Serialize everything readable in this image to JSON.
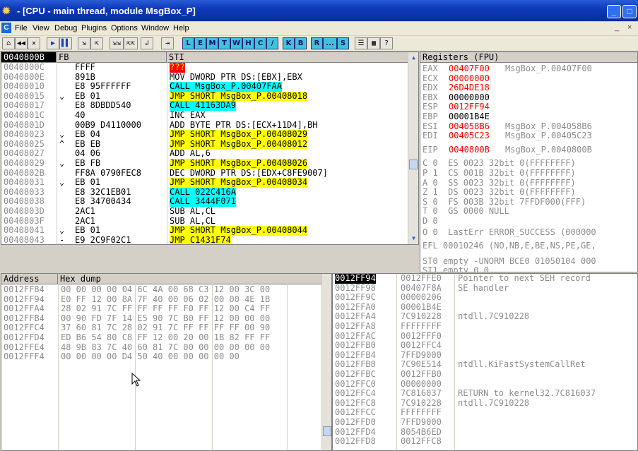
{
  "window": {
    "title": "- [CPU - main thread, module MsgBox_P]",
    "min": "_",
    "max": "□",
    "close": "✕"
  },
  "menu": [
    "File",
    "View",
    "Debug",
    "Plugins",
    "Options",
    "Window",
    "Help"
  ],
  "menu_c": "C",
  "menu_right_min": "_",
  "menu_right_close": "×",
  "toolbar": {
    "std": [
      "⌂",
      "◀◀",
      "✕",
      "▶",
      "▌▌",
      "⇲",
      "⇱",
      "⇲⇲",
      "⇱⇱",
      "↲",
      "⇥"
    ],
    "letters": [
      "L",
      "E",
      "M",
      "T",
      "W",
      "H",
      "C",
      "/",
      "K",
      "B",
      "R",
      "...",
      "S"
    ],
    "extra": [
      "☰",
      "▦",
      "?"
    ]
  },
  "disasm": {
    "headers": [
      "0040800B",
      "FB",
      "STI"
    ],
    "rows": [
      {
        "addr": "0040800C",
        "jmp": " ",
        "hex": "FFFF",
        "ins": "???",
        "cls": "redbg"
      },
      {
        "addr": "0040800E",
        "jmp": " ",
        "hex": "891B",
        "ins": "MOV DWORD PTR DS:[EBX],EBX",
        "cls": ""
      },
      {
        "addr": "00408010",
        "jmp": " ",
        "hex": "E8 95FFFFFF",
        "ins": "CALL MsgBox_P.00407FAA",
        "cls": "cy"
      },
      {
        "addr": "00408015",
        "jmp": "⌄",
        "hex": "EB 01",
        "ins": "JMP SHORT MsgBox_P.00408018",
        "cls": "hl"
      },
      {
        "addr": "00408017",
        "jmp": " ",
        "hex": "E8 8DBDD540",
        "ins": "CALL 41163DA9",
        "cls": "cy"
      },
      {
        "addr": "0040801C",
        "jmp": " ",
        "hex": "40",
        "ins": "INC EAX",
        "cls": ""
      },
      {
        "addr": "0040801D",
        "jmp": " ",
        "hex": "00B9 D4110000",
        "ins": "ADD BYTE PTR DS:[ECX+11D4],BH",
        "cls": ""
      },
      {
        "addr": "00408023",
        "jmp": "⌄",
        "hex": "EB 04",
        "ins": "JMP SHORT MsgBox_P.00408029",
        "cls": "hl"
      },
      {
        "addr": "00408025",
        "jmp": "^",
        "hex": "EB EB",
        "ins": "JMP SHORT MsgBox_P.00408012",
        "cls": "hl"
      },
      {
        "addr": "00408027",
        "jmp": " ",
        "hex": "04 06",
        "ins": "ADD AL,6",
        "cls": ""
      },
      {
        "addr": "00408029",
        "jmp": "⌄",
        "hex": "EB FB",
        "ins": "JMP SHORT MsgBox_P.00408026",
        "cls": "hl"
      },
      {
        "addr": "0040802B",
        "jmp": " ",
        "hex": "FF8A 0790FEC8",
        "ins": "DEC DWORD PTR DS:[EDX+C8FE9007]",
        "cls": ""
      },
      {
        "addr": "00408031",
        "jmp": "⌄",
        "hex": "EB 01",
        "ins": "JMP SHORT MsgBox_P.00408034",
        "cls": "hl"
      },
      {
        "addr": "00408033",
        "jmp": " ",
        "hex": "E8 32C1EB01",
        "ins": "CALL 022C416A",
        "cls": "cy"
      },
      {
        "addr": "00408038",
        "jmp": " ",
        "hex": "E8 34700434",
        "ins": "CALL 3444F071",
        "cls": "cy"
      },
      {
        "addr": "0040803D",
        "jmp": " ",
        "hex": "2AC1",
        "ins": "SUB AL,CL",
        "cls": ""
      },
      {
        "addr": "0040803F",
        "jmp": " ",
        "hex": "2AC1",
        "ins": "SUB AL,CL",
        "cls": ""
      },
      {
        "addr": "00408041",
        "jmp": "⌄",
        "hex": "EB 01",
        "ins": "JMP SHORT MsgBox_P.00408044",
        "cls": "hl"
      },
      {
        "addr": "00408043",
        "jmp": "-",
        "hex": "E9 2C9F02C1",
        "ins": "JMP C1431F74",
        "cls": "hl"
      }
    ]
  },
  "registers": {
    "header": "Registers (FPU)",
    "regs": [
      {
        "name": "EAX",
        "val": "00407F00",
        "comment": "MsgBox_P.00407F00",
        "red": true
      },
      {
        "name": "ECX",
        "val": "00000000",
        "comment": "",
        "red": true
      },
      {
        "name": "EDX",
        "val": "26D4DE18",
        "comment": "",
        "red": true
      },
      {
        "name": "EBX",
        "val": "00000000",
        "comment": "",
        "red": false
      },
      {
        "name": "ESP",
        "val": "0012FF94",
        "comment": "",
        "red": true
      },
      {
        "name": "EBP",
        "val": "00001B4E",
        "comment": "",
        "red": false
      },
      {
        "name": "ESI",
        "val": "004058B6",
        "comment": "MsgBox_P.004058B6",
        "red": true
      },
      {
        "name": "EDI",
        "val": "00405C23",
        "comment": "MsgBox_P.00405C23",
        "red": true
      }
    ],
    "eip": {
      "name": "EIP",
      "val": "0040800B",
      "comment": "MsgBox_P.0040800B"
    },
    "flags": [
      "C 0  ES 0023 32bit 0(FFFFFFFF)",
      "P 1  CS 001B 32bit 0(FFFFFFFF)",
      "A 0  SS 0023 32bit 0(FFFFFFFF)",
      "Z 1  DS 0023 32bit 0(FFFFFFFF)",
      "S 0  FS 003B 32bit 7FFDF000(FFF)",
      "T 0  GS 0000 NULL",
      "D 0",
      "O 0  LastErr ERROR_SUCCESS (000000"
    ],
    "efl": "EFL 00010246 (NO,NB,E,BE,NS,PE,GE,",
    "st0": "ST0 empty -UNORM BCE0 01050104 000",
    "st1": "ST1 empty 0.0"
  },
  "dump": {
    "headers": [
      "Address",
      "Hex dump"
    ],
    "rows": [
      {
        "addr": "0012FF84",
        "hex": "00 00 00 00 04 6C 4A 00 68 C3 12 00 3C 00"
      },
      {
        "addr": "0012FF94",
        "hex": "E0 FF 12 00 8A 7F 40 00 06 02 00 00 4E 1B"
      },
      {
        "addr": "0012FFA4",
        "hex": "28 02 91 7C FF FF FF FF F0 FF 12 00 C4 FF"
      },
      {
        "addr": "0012FFB4",
        "hex": "00 90 FD 7F 14 E5 90 7C B0 FF 12 00 00 00"
      },
      {
        "addr": "0012FFC4",
        "hex": "37 60 81 7C 28 02 91 7C FF FF FF FF 00 90"
      },
      {
        "addr": "0012FFD4",
        "hex": "ED B6 54 80 C8 FF 12 00 20 00 1B 82 FF FF"
      },
      {
        "addr": "0012FFE4",
        "hex": "48 9B 83 7C 40 60 81 7C 00 00 00 00 00 00"
      },
      {
        "addr": "0012FFF4",
        "hex": "00 00 00 00 D4 50 40 00 00 00 00 00"
      }
    ]
  },
  "stack": {
    "rows": [
      {
        "addr": "0012FF94",
        "val": "0012FFE0",
        "comment": "Pointer to next SEH record"
      },
      {
        "addr": "0012FF98",
        "val": "00407F8A",
        "comment": "SE handler"
      },
      {
        "addr": "0012FF9C",
        "val": "00000206",
        "comment": ""
      },
      {
        "addr": "0012FFA0",
        "val": "00001B4E",
        "comment": ""
      },
      {
        "addr": "0012FFA4",
        "val": "7C910228",
        "comment": "ntdll.7C910228"
      },
      {
        "addr": "0012FFA8",
        "val": "FFFFFFFF",
        "comment": ""
      },
      {
        "addr": "0012FFAC",
        "val": "0012FFF0",
        "comment": ""
      },
      {
        "addr": "0012FFB0",
        "val": "0012FFC4",
        "comment": ""
      },
      {
        "addr": "0012FFB4",
        "val": "7FFD9000",
        "comment": ""
      },
      {
        "addr": "0012FFB8",
        "val": "7C90E514",
        "comment": "ntdll.KiFastSystemCallRet"
      },
      {
        "addr": "0012FFBC",
        "val": "0012FFB0",
        "comment": ""
      },
      {
        "addr": "0012FFC0",
        "val": "00000000",
        "comment": ""
      },
      {
        "addr": "0012FFC4",
        "val": "7C816037",
        "comment": "RETURN to kernel32.7C816037"
      },
      {
        "addr": "0012FFC8",
        "val": "7C910228",
        "comment": "ntdll.7C910228"
      },
      {
        "addr": "0012FFCC",
        "val": "FFFFFFFF",
        "comment": ""
      },
      {
        "addr": "0012FFD0",
        "val": "7FFD9000",
        "comment": ""
      },
      {
        "addr": "0012FFD4",
        "val": "8054B6ED",
        "comment": ""
      },
      {
        "addr": "0012FFD8",
        "val": "0012FFC8",
        "comment": ""
      }
    ]
  }
}
